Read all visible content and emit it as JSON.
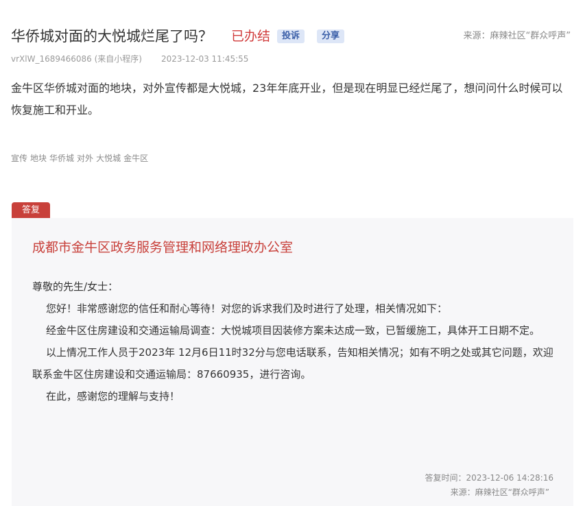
{
  "post": {
    "title": "华侨城对面的大悦城烂尾了吗？",
    "status": "已办结",
    "tags": [
      "投诉",
      "分享"
    ],
    "source": "来源：麻辣社区“群众呼声”",
    "user": "vrXlW_1689466086 (来自小程序)",
    "time": "2023-12-03 11:45:55",
    "content": "金牛区华侨城对面的地块，对外宣传都是大悦城，23年年底开业，但是现在明显已经烂尾了，想问问什么时候可以恢复施工和开业。",
    "keywords": [
      "宣传",
      "地块",
      "华侨城",
      "对外",
      "大悦城",
      "金牛区"
    ]
  },
  "reply": {
    "label": "答复",
    "org": "成都市金牛区政务服务管理和网络理政办公室",
    "greeting": "尊敬的先生/女士：",
    "paragraphs": [
      "您好！非常感谢您的信任和耐心等待！对您的诉求我们及时进行了处理，相关情况如下：",
      "经金牛区住房建设和交通运输局调查：大悦城项目因装修方案未达成一致，已暂缓施工，具体开工日期不定。",
      "以上情况工作人员于2023年 12月6日11时32分与您电话联系，告知相关情况；如有不明之处或其它问题，欢迎联系金牛区住房建设和交通运输局：87660935，进行咨询。",
      "在此，感谢您的理解与支持！"
    ],
    "time": "答复时间：2023-12-06 14:28:16",
    "source": "来源：麻辣社区“群众呼声”"
  }
}
